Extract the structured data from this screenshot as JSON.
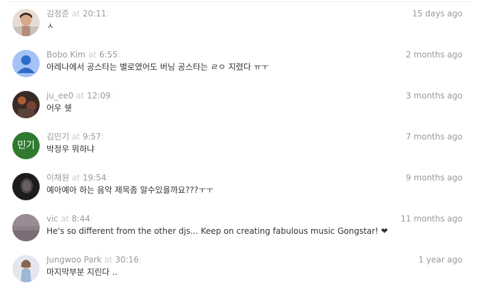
{
  "comments": [
    {
      "user": "김정준",
      "at": "at",
      "time": "20:11",
      "text": "ㅅ",
      "ago": "15 days ago",
      "avatar": "photo-avatar-1"
    },
    {
      "user": "Bobo Kim",
      "at": "at",
      "time": "6:55",
      "text": "아레나에서 공스타는 별로였어도 버닝 공스타는 ㄹㅇ 지렸다 ㅠㅜ",
      "ago": "2 months ago",
      "avatar": "default-user-avatar"
    },
    {
      "user": "ju_ee0",
      "at": "at",
      "time": "12:09",
      "text": "어우 쉣",
      "ago": "3 months ago",
      "avatar": "photo-avatar-3"
    },
    {
      "user": "김민기",
      "at": "at",
      "time": "9:57",
      "text": "박정우 뭐하냐",
      "ago": "7 months ago",
      "avatar": "initials-avatar",
      "avatar_text": "민기"
    },
    {
      "user": "이채원",
      "at": "at",
      "time": "19:54",
      "text": "예아예아 하는 음악 제목좀 알수있을까요???ㅜㅜ",
      "ago": "9 months ago",
      "avatar": "photo-avatar-5"
    },
    {
      "user": "vic",
      "at": "at",
      "time": "8:44",
      "text": "He's so different from the other djs... Keep on creating fabulous music Gongstar! ❤",
      "ago": "11 months ago",
      "avatar": "photo-avatar-6"
    },
    {
      "user": "Jungwoo Park",
      "at": "at",
      "time": "30:16",
      "text": "마지막부분 지린다 ..",
      "ago": "1 year ago",
      "avatar": "photo-avatar-7"
    }
  ],
  "colors": {
    "meta_gray": "#999999",
    "body_text": "#333333",
    "default_avatar_bg": "#a4c2f4",
    "default_avatar_fg": "#2f6cc9",
    "initials_avatar_bg": "#2f7a2f"
  }
}
